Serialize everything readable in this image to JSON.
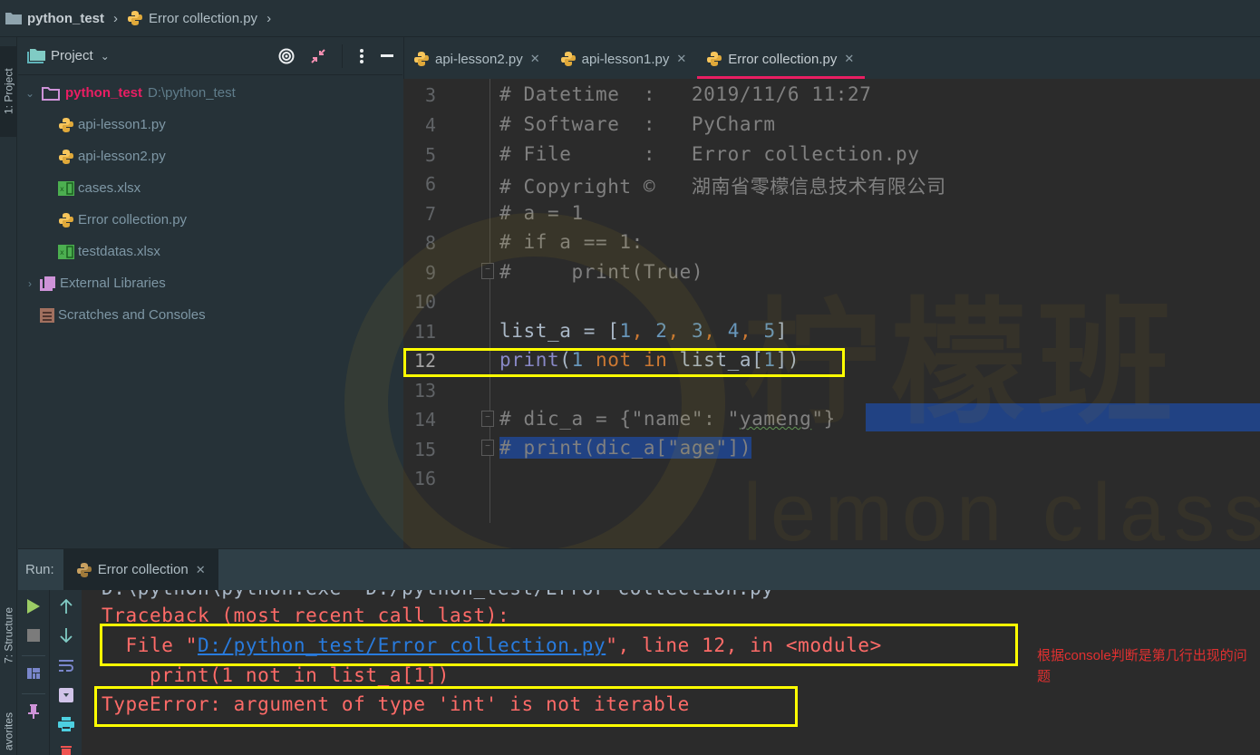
{
  "breadcrumb": {
    "project": "python_test",
    "file": "Error collection.py"
  },
  "left_strip": {
    "project_tab": "1: Project",
    "structure_tab": "7: Structure",
    "favorites_tab": "avorites"
  },
  "project_panel": {
    "title": "Project",
    "tools": [
      "locate-icon",
      "collapse-icon",
      "more-icon",
      "hide-icon"
    ],
    "root": {
      "name": "python_test",
      "path": "D:\\python_test"
    },
    "files": [
      {
        "name": "api-lesson1.py",
        "icon": "python-file-icon"
      },
      {
        "name": "api-lesson2.py",
        "icon": "python-file-icon"
      },
      {
        "name": "cases.xlsx",
        "icon": "excel-file-icon"
      },
      {
        "name": "Error collection.py",
        "icon": "python-file-icon"
      },
      {
        "name": "testdatas.xlsx",
        "icon": "excel-file-icon"
      }
    ],
    "external_libraries": "External Libraries",
    "scratches": "Scratches and Consoles"
  },
  "editor_tabs": [
    {
      "label": "api-lesson2.py",
      "active": false
    },
    {
      "label": "api-lesson1.py",
      "active": false
    },
    {
      "label": "Error collection.py",
      "active": true
    }
  ],
  "editor": {
    "current_line": 12,
    "lines": [
      {
        "no": "3",
        "text": "# Datetime  :   2019/11/6 11:27"
      },
      {
        "no": "4",
        "text": "# Software  :   PyCharm"
      },
      {
        "no": "5",
        "text": "# File      :   Error collection.py"
      },
      {
        "no": "6",
        "text": "# Copyright ©   湖南省零檬信息技术有限公司"
      },
      {
        "no": "7",
        "text": "# a = 1"
      },
      {
        "no": "8",
        "text": "# if a == 1:"
      },
      {
        "no": "9",
        "text": "#     print(True)"
      },
      {
        "no": "10",
        "text": ""
      },
      {
        "no": "11",
        "text": "list_a = [1, 2, 3, 4, 5]"
      },
      {
        "no": "12",
        "text": "print(1 not in list_a[1])"
      },
      {
        "no": "13",
        "text": ""
      },
      {
        "no": "14",
        "text": "# dic_a = {\"name\": \"yameng\"}"
      },
      {
        "no": "15",
        "text": "# print(dic_a[\"age\"])"
      },
      {
        "no": "16",
        "text": ""
      }
    ],
    "tokens": {
      "l11_var": "list_a = [",
      "l11_n1": "1",
      "l11_c1": ", ",
      "l11_n2": "2",
      "l11_c2": ", ",
      "l11_n3": "3",
      "l11_c3": ", ",
      "l11_n4": "4",
      "l11_c4": ", ",
      "l11_n5": "5",
      "l11_end": "]",
      "l12_print": "print",
      "l12_open": "(",
      "l12_n1": "1 ",
      "l12_kw": "not in",
      "l12_rest": " list_a[",
      "l12_idx": "1",
      "l12_end": "])",
      "l14_a": "# dic_a = {\"name\": \"",
      "l14_word": "yameng",
      "l14_b": "\"",
      "l14_c": "}",
      "l15": "# print(dic_a[\"age\"])"
    },
    "watermark": {
      "title": "柠檬班",
      "subtitle": "lemon class"
    }
  },
  "run_panel": {
    "label": "Run:",
    "tab": "Error collection",
    "console": {
      "cmd": "D:\\python\\python.exe \"D:/python_test/Error collection.py\"",
      "traceback": "Traceback (most recent call last):",
      "file_prefix": "  File \"",
      "file_link": "D:/python_test/Error collection.py",
      "file_suffix": "\", line 12, in <module>",
      "code": "    print(1 not in list_a[1])",
      "error": "TypeError: argument of type 'int' is not iterable"
    }
  },
  "annotation": "根据console判断是第几行出现的问题",
  "colors": {
    "accent": "#e91e63",
    "highlight_box": "#ffff00",
    "error_text": "#ff6b68",
    "link": "#287bde",
    "selection": "#214283"
  }
}
